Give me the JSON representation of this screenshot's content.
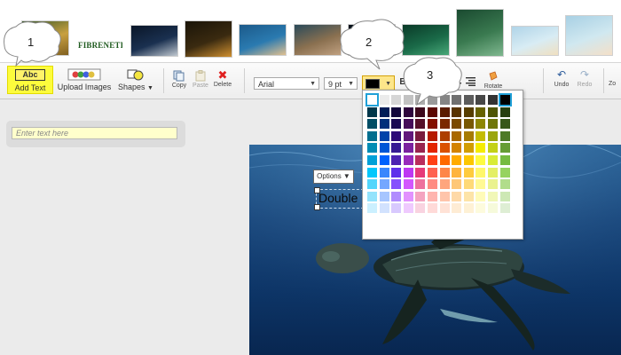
{
  "thumbnails": [
    {
      "id": "thumb-fish-yellow",
      "colors": [
        "#3a5a2a",
        "#c8a040",
        "#806020"
      ]
    },
    {
      "id": "thumb-fibrenetics-logo",
      "logo": "FIBRENETICS"
    },
    {
      "id": "thumb-shark",
      "colors": [
        "#0a1628",
        "#1a3050",
        "#c0c8d0"
      ]
    },
    {
      "id": "thumb-poster",
      "colors": [
        "#1a1408",
        "#3a2a10",
        "#d09030"
      ]
    },
    {
      "id": "thumb-triggerfish",
      "colors": [
        "#1c5a8a",
        "#2a7ab0",
        "#e0c090"
      ]
    },
    {
      "id": "thumb-flatfish",
      "colors": [
        "#2a4a5a",
        "#8a7050",
        "#c0a080"
      ]
    },
    {
      "id": "thumb-dark-water",
      "colors": [
        "#051018",
        "#0a2030",
        "#102838"
      ]
    },
    {
      "id": "thumb-diver-green",
      "colors": [
        "#0a3a28",
        "#1a6a48",
        "#48a878"
      ]
    },
    {
      "id": "thumb-wreck-green",
      "colors": [
        "#1a4a30",
        "#3a7a50",
        "#80b890"
      ]
    },
    {
      "id": "thumb-jellyfish-1",
      "colors": [
        "#b0d4e8",
        "#d8ecf4",
        "#f0e0c0"
      ]
    },
    {
      "id": "thumb-jellyfish-2",
      "colors": [
        "#a8d0e4",
        "#d0e8f0",
        "#f4e0c8"
      ]
    }
  ],
  "toolbar": {
    "add_text": {
      "icon_text": "Abc",
      "label": "Add Text"
    },
    "upload_images": {
      "label": "Upload Images"
    },
    "shapes": {
      "label": "Shapes"
    },
    "copy": {
      "label": "Copy"
    },
    "paste": {
      "label": "Paste"
    },
    "delete": {
      "label": "Delete"
    },
    "font": {
      "value": "Arial"
    },
    "size": {
      "value": "9 pt"
    },
    "color": {
      "value": "#000000"
    },
    "bold": {
      "label": "B"
    },
    "rotate": {
      "label": "Rotate"
    },
    "undo": {
      "label": "Undo"
    },
    "redo": {
      "label": "Redo"
    },
    "zoom": {
      "label": "Zo"
    }
  },
  "text_input": {
    "placeholder": "Enter text here",
    "value": ""
  },
  "canvas": {
    "options_label": "Options ▼",
    "text_object": "Double"
  },
  "callouts": [
    {
      "number": "1"
    },
    {
      "number": "2"
    },
    {
      "number": "3"
    }
  ],
  "palette": {
    "grey_row": [
      "#ffffff",
      "#ebebeb",
      "#d6d6d6",
      "#c2c2c2",
      "#adadad",
      "#999999",
      "#858585",
      "#707070",
      "#5c5c5c",
      "#474747",
      "#333333",
      "#000000"
    ],
    "rows": [
      [
        "#00374a",
        "#011d57",
        "#11053b",
        "#2e063d",
        "#3c071b",
        "#5c0701",
        "#5a1c00",
        "#583300",
        "#563d00",
        "#666100",
        "#4f5504",
        "#263e0f"
      ],
      [
        "#004d65",
        "#012f7b",
        "#1a0a52",
        "#450d59",
        "#551029",
        "#831100",
        "#7b2900",
        "#7a4a00",
        "#785800",
        "#8d8602",
        "#6f760a",
        "#38571a"
      ],
      [
        "#016e8f",
        "#0042a9",
        "#2c0977",
        "#61187c",
        "#791a3d",
        "#b51a00",
        "#ad3e00",
        "#a96800",
        "#a67b01",
        "#c4bc00",
        "#9ba50e",
        "#4e7a27"
      ],
      [
        "#008cb4",
        "#0056d6",
        "#371a94",
        "#7a219e",
        "#99244f",
        "#e22400",
        "#da5100",
        "#d38301",
        "#d19d01",
        "#f5ec00",
        "#c3d117",
        "#669d34"
      ],
      [
        "#00a1d8",
        "#0061fd",
        "#4d22b2",
        "#982abc",
        "#b92d5d",
        "#ff4015",
        "#ff6a00",
        "#ffab01",
        "#fcc700",
        "#fefb41",
        "#d9ec37",
        "#76bb40"
      ],
      [
        "#01c7fc",
        "#3a87fd",
        "#5e30eb",
        "#be38f3",
        "#e63b7a",
        "#fe6250",
        "#fe8648",
        "#feb43f",
        "#fecb3e",
        "#fff76b",
        "#e4ef65",
        "#96d35f"
      ],
      [
        "#52d6fc",
        "#74a7ff",
        "#864ffd",
        "#d357fe",
        "#ee719e",
        "#ff8c82",
        "#fea57d",
        "#fec777",
        "#fed977",
        "#fff994",
        "#eaf28f",
        "#b1dd8b"
      ],
      [
        "#93e3fc",
        "#a7c6ff",
        "#b18cfe",
        "#e292fe",
        "#f4a4c0",
        "#ffb5af",
        "#ffc5ab",
        "#fed9a8",
        "#fde4a8",
        "#fffbb9",
        "#f1f7b7",
        "#cde8b5"
      ],
      [
        "#cbf0ff",
        "#d2e2fe",
        "#d8c9fe",
        "#efcafe",
        "#f9d3e0",
        "#ffdad8",
        "#ffe2d6",
        "#feecd4",
        "#fef1d5",
        "#fdfbdd",
        "#f6fadb",
        "#deeed4"
      ]
    ]
  }
}
